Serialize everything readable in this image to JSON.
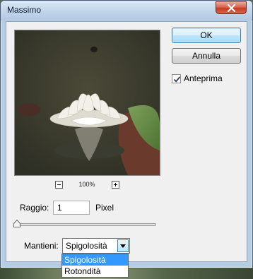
{
  "window": {
    "title": "Massimo"
  },
  "buttons": {
    "ok": "OK",
    "cancel": "Annulla"
  },
  "preview": {
    "zoom": "100%"
  },
  "anteprima": {
    "label": "Anteprima",
    "checked": true
  },
  "raggio": {
    "label": "Raggio:",
    "value": "1",
    "unit": "Pixel",
    "slider_fraction": 0.0
  },
  "mantieni": {
    "label": "Mantieni:",
    "selected": "Spigolosità",
    "options": [
      "Spigolosità",
      "Rotondità"
    ],
    "highlighted_index": 0
  },
  "colors": {
    "accent": "#3399ff",
    "close": "#c43c22"
  }
}
